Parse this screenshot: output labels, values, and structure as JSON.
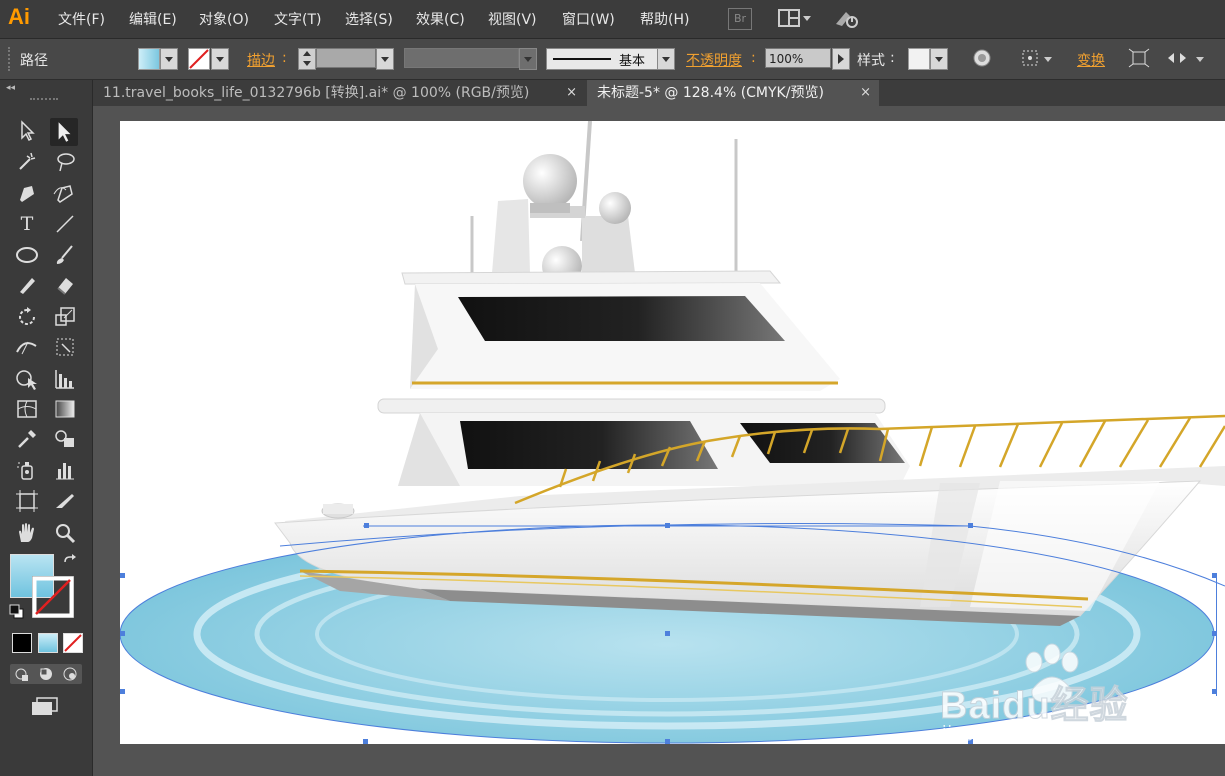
{
  "app": {
    "logo": "Ai"
  },
  "menu": [
    "文件(F)",
    "编辑(E)",
    "对象(O)",
    "文字(T)",
    "选择(S)",
    "效果(C)",
    "视图(V)",
    "窗口(W)",
    "帮助(H)"
  ],
  "menubar_icons": {
    "bridge": "Br",
    "workspace": "workspace-layout-icon",
    "sync": "sync-icon"
  },
  "control": {
    "selection_type": "路径",
    "stroke_label": "描边",
    "stroke_value": "",
    "stroke_line": "基本",
    "opacity_label": "不透明度",
    "opacity_value": "100%",
    "style_label": "样式",
    "transform_label": "变换"
  },
  "tabs": [
    {
      "label": "11.travel_books_life_0132796b [转换].ai* @ 100% (RGB/预览)",
      "close": "×"
    },
    {
      "label": "未标题-5* @ 128.4% (CMYK/预览)",
      "close": "×",
      "active": true
    }
  ],
  "fill_color": "#8fd1e6",
  "stroke_color": "none",
  "watermark": {
    "brand": "Baidu经验",
    "url": "jingyan.baidu.com"
  }
}
